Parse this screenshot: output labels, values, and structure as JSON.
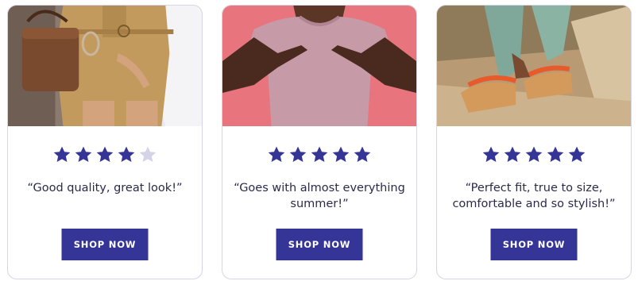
{
  "colors": {
    "star_filled": "#343597",
    "star_empty": "#d4d4e6",
    "button_bg": "#343597",
    "text": "#2b2a4a"
  },
  "cards": [
    {
      "rating": 4,
      "max_rating": 5,
      "quote": "“Good quality, great look!”",
      "button_label": "SHOP NOW"
    },
    {
      "rating": 5,
      "max_rating": 5,
      "quote": "“Goes with almost everything summer!”",
      "button_label": "SHOP NOW"
    },
    {
      "rating": 5,
      "max_rating": 5,
      "quote": "“Perfect fit, true to size, comfortable and so stylish!”",
      "button_label": "SHOP NOW"
    }
  ]
}
